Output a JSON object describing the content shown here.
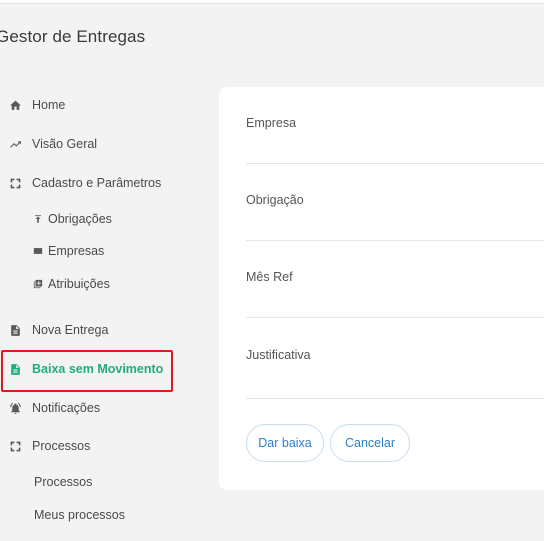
{
  "app": {
    "title": "Gestor de Entregas"
  },
  "sidebar": {
    "items": [
      {
        "label": "Home",
        "icon": "home-icon"
      },
      {
        "label": "Visão Geral",
        "icon": "trending-up-icon"
      },
      {
        "label": "Cadastro e Parâmetros",
        "icon": "expand-icon"
      },
      {
        "label": "Nova Entrega",
        "icon": "document-icon"
      },
      {
        "label": "Baixa sem Movimento",
        "icon": "document-icon",
        "active": true
      },
      {
        "label": "Notificações",
        "icon": "bell-icon"
      },
      {
        "label": "Processos",
        "icon": "expand-icon"
      }
    ],
    "cadastro_sub": [
      {
        "label": "Obrigações",
        "icon": "upload-icon"
      },
      {
        "label": "Empresas",
        "icon": "card-icon"
      },
      {
        "label": "Atribuições",
        "icon": "copy-plus-icon"
      }
    ],
    "processos_sub": [
      {
        "label": "Processos"
      },
      {
        "label": "Meus processos"
      }
    ]
  },
  "form": {
    "fields": [
      {
        "label": "Empresa",
        "value": ""
      },
      {
        "label": "Obrigação",
        "value": ""
      },
      {
        "label": "Mês Ref",
        "value": ""
      },
      {
        "label": "Justificativa",
        "value": ""
      }
    ],
    "submit_label": "Dar baixa",
    "cancel_label": "Cancelar"
  },
  "colors": {
    "active": "#1fae7a",
    "highlight": "#e01b1b",
    "button_text": "#2d7fc9",
    "background": "#f3f3f3"
  }
}
